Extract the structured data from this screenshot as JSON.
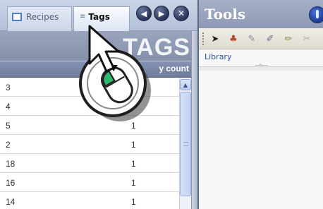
{
  "tabs": [
    {
      "label": "Recipes",
      "icon": "recipe-box-icon",
      "active": false
    },
    {
      "label": "Tags",
      "icon": "tag-list-icon",
      "active": true
    }
  ],
  "nav": {
    "prev_icon": "◀",
    "next_icon": "▶",
    "close_icon": "✕"
  },
  "banner": {
    "title": "TAGS"
  },
  "table": {
    "count_header": "y count",
    "rows": [
      {
        "id": "3",
        "count": ""
      },
      {
        "id": "4",
        "count": ""
      },
      {
        "id": "5",
        "count": "1"
      },
      {
        "id": "2",
        "count": "1"
      },
      {
        "id": "18",
        "count": "1"
      },
      {
        "id": "16",
        "count": "1"
      },
      {
        "id": "14",
        "count": "1"
      }
    ]
  },
  "scrollbar": {
    "up_arrow": "▲"
  },
  "tools": {
    "title": "Tools",
    "toolbar": [
      {
        "name": "pointer-tool-icon",
        "glyph": "➤"
      },
      {
        "name": "stamp-tool-icon",
        "glyph": "♣"
      },
      {
        "name": "tag-tool-icon",
        "glyph": "✎"
      },
      {
        "name": "tag-add-tool-icon",
        "glyph": "✐"
      },
      {
        "name": "tag-edit-tool-icon",
        "glyph": "✏"
      },
      {
        "name": "tag-remove-tool-icon",
        "glyph": "✂"
      }
    ],
    "library_label": "Library"
  },
  "colors": {
    "tab_strip": "#b3c0d8",
    "banner": "#9aa4bc",
    "header": "#6e7b9c",
    "mouse_highlight": "#2fb873"
  }
}
